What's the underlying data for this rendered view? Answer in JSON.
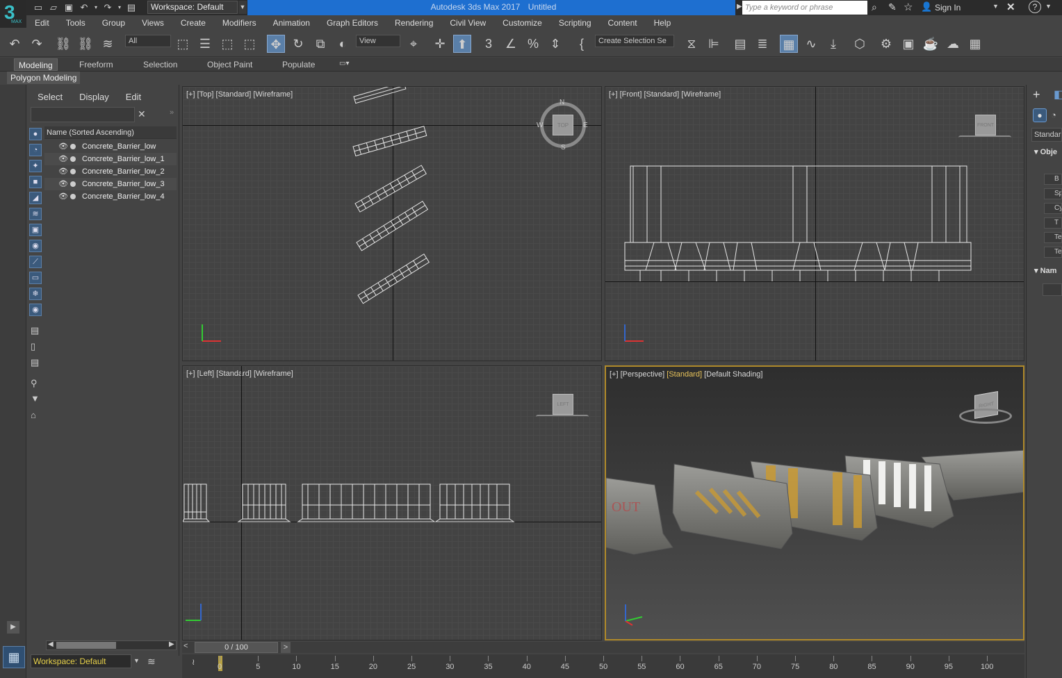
{
  "titlebar": {
    "app_title": "Autodesk 3ds Max 2017",
    "doc_title": "Untitled",
    "workspace": "Workspace: Default",
    "search_placeholder": "Type a keyword or phrase",
    "sign_in": "Sign In",
    "logo_text": "3",
    "logo_sub": "MAX",
    "help": "?"
  },
  "menubar": [
    "Edit",
    "Tools",
    "Group",
    "Views",
    "Create",
    "Modifiers",
    "Animation",
    "Graph Editors",
    "Rendering",
    "Civil View",
    "Customize",
    "Scripting",
    "Content",
    "Help"
  ],
  "toolbar": {
    "filter_value": "All",
    "ref_coord_value": "View",
    "selection_set_placeholder": "Create Selection Se"
  },
  "ribbon": {
    "tabs": [
      "Modeling",
      "Freeform",
      "Selection",
      "Object Paint",
      "Populate"
    ],
    "active_tab": "Modeling",
    "panel": "Polygon Modeling"
  },
  "scene_explorer": {
    "tabs": [
      "Select",
      "Display",
      "Edit"
    ],
    "column_header": "Name (Sorted Ascending)",
    "objects": [
      "Concrete_Barrier_low",
      "Concrete_Barrier_low_1",
      "Concrete_Barrier_low_2",
      "Concrete_Barrier_low_3",
      "Concrete_Barrier_low_4"
    ]
  },
  "viewports": {
    "top": {
      "plus": "[+]",
      "view": "[Top]",
      "style": "[Standard]",
      "shading": "[Wireframe]",
      "cube": "TOP",
      "compass": {
        "n": "N",
        "s": "S",
        "e": "E",
        "w": "W"
      }
    },
    "front": {
      "plus": "[+]",
      "view": "[Front]",
      "style": "[Standard]",
      "shading": "[Wireframe]",
      "cube": "FRONT"
    },
    "left": {
      "plus": "[+]",
      "view": "[Left]",
      "style": "[Standard]",
      "shading": "[Wireframe]",
      "cube": "LEFT"
    },
    "perspective": {
      "plus": "[+]",
      "view": "[Perspective]",
      "style": "[Standard]",
      "shading": "[Default Shading]",
      "cube": "RIGHT",
      "barrier_text": "OUT"
    }
  },
  "timeline": {
    "slider": "0 / 100",
    "ticks": [
      "0",
      "5",
      "10",
      "15",
      "20",
      "25",
      "30",
      "35",
      "40",
      "45",
      "50",
      "55",
      "60",
      "65",
      "70",
      "75",
      "80",
      "85",
      "90",
      "95",
      "100"
    ]
  },
  "command_panel": {
    "dropdown": "Standard",
    "rollout_object_type": "Obje",
    "rollout_name": "Nam",
    "buttons": [
      "B",
      "Sp",
      "Cy",
      "T",
      "Te",
      "Tex"
    ]
  },
  "bottom": {
    "workspace": "Workspace: Default"
  },
  "colors": {
    "titlebar": "#1e6fd0",
    "active_viewport_border": "#b08a2a",
    "logo": "#3ac0c8"
  }
}
